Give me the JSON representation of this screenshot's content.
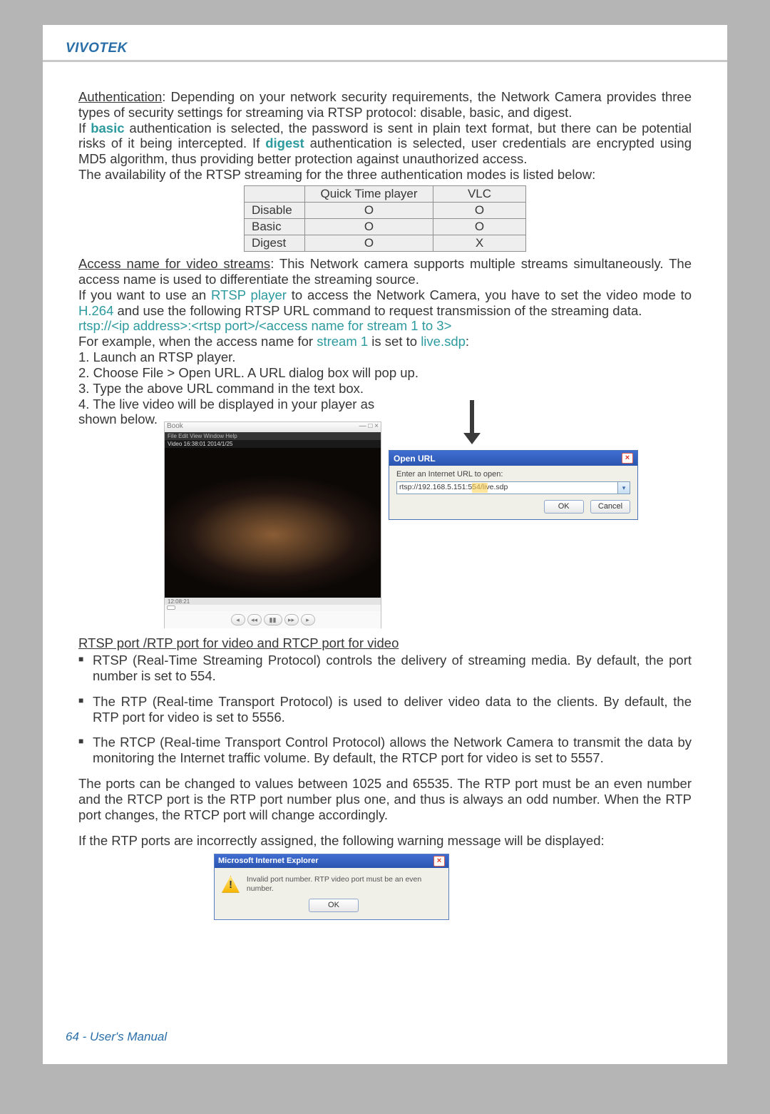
{
  "brand": "VIVOTEK",
  "footer": "64 - User's Manual",
  "para": {
    "auth_label": "Authentication",
    "auth_rest": ": Depending on your network security requirements, the Network Camera provides three types of security settings for streaming via RTSP protocol: disable, basic, and digest.",
    "line2a": "If ",
    "kw_basic": "basic",
    "line2b": " authentication is selected, the password is sent in plain text format, but there can be potential risks of it being intercepted. If ",
    "kw_digest": "digest",
    "line2c": " authentication is selected, user credentials are encrypted using MD5 algorithm, thus providing better protection against unauthorized access.",
    "line3": "The availability of the RTSP streaming for the three authentication modes is listed below:"
  },
  "auth_table": {
    "headers": [
      "",
      "Quick Time player",
      "VLC"
    ],
    "rows": [
      [
        "Disable",
        "O",
        "O"
      ],
      [
        "Basic",
        "O",
        "O"
      ],
      [
        "Digest",
        "O",
        "X"
      ]
    ]
  },
  "access": {
    "title": "Access name for video streams",
    "rest": ": This Network camera supports multiple streams simultaneously. The access name is used to differentiate the streaming source.",
    "l1a": "If you want to use an ",
    "kw_rtsp_player": "RTSP player",
    "l1b": " to access the Network Camera, you have to set the video mode to ",
    "kw_h264": "H.264",
    "l1c": " and use the following RTSP URL command to request transmission of the streaming data.",
    "url_tpl": "rtsp://<ip address>:<rtsp port>/<access name for stream 1 to 3>",
    "l2a": "For example, when the access name for ",
    "kw_stream1": "stream 1",
    "l2b": " is set to ",
    "kw_live": "live.sdp",
    "l2c": ":",
    "steps": [
      "1. Launch an RTSP player.",
      "2. Choose File > Open URL. A URL dialog box will pop up.",
      "3. Type the above URL command in the text box.",
      "4. The live video will be displayed in your player as shown below."
    ]
  },
  "player": {
    "title": "Book",
    "menubar": "File  Edit  View  Window  Help",
    "timestamp": "Video 16:38:01 2014/1/25",
    "status": "12:08:21"
  },
  "openurl": {
    "title": "Open URL",
    "label": "Enter an Internet URL to open:",
    "value": "rtsp://192.168.5.151:554/live.sdp",
    "ok": "OK",
    "cancel": "Cancel"
  },
  "ports": {
    "heading": "RTSP port /RTP port for video and RTCP port for video",
    "bullets": [
      "RTSP (Real-Time Streaming Protocol) controls the delivery of streaming media. By default, the port number is set to 554.",
      "The RTP (Real-time Transport Protocol) is used to deliver video data to the clients. By default, the RTP port for video is set to 5556.",
      "The RTCP (Real-time Transport Control Protocol) allows the Network Camera to transmit the data by monitoring the Internet traffic volume. By default, the RTCP port for video is set to 5557."
    ],
    "p1": "The ports can be changed to values between 1025 and 65535. The RTP port must be an even number and the RTCP port is the RTP port number plus one, and thus is always an odd number. When the RTP port changes, the RTCP port will change accordingly.",
    "p2": "If the RTP ports are incorrectly assigned, the following warning message will be displayed:"
  },
  "iewarn": {
    "title": "Microsoft Internet Explorer",
    "msg": "Invalid port number. RTP video port must be an even number.",
    "ok": "OK"
  }
}
